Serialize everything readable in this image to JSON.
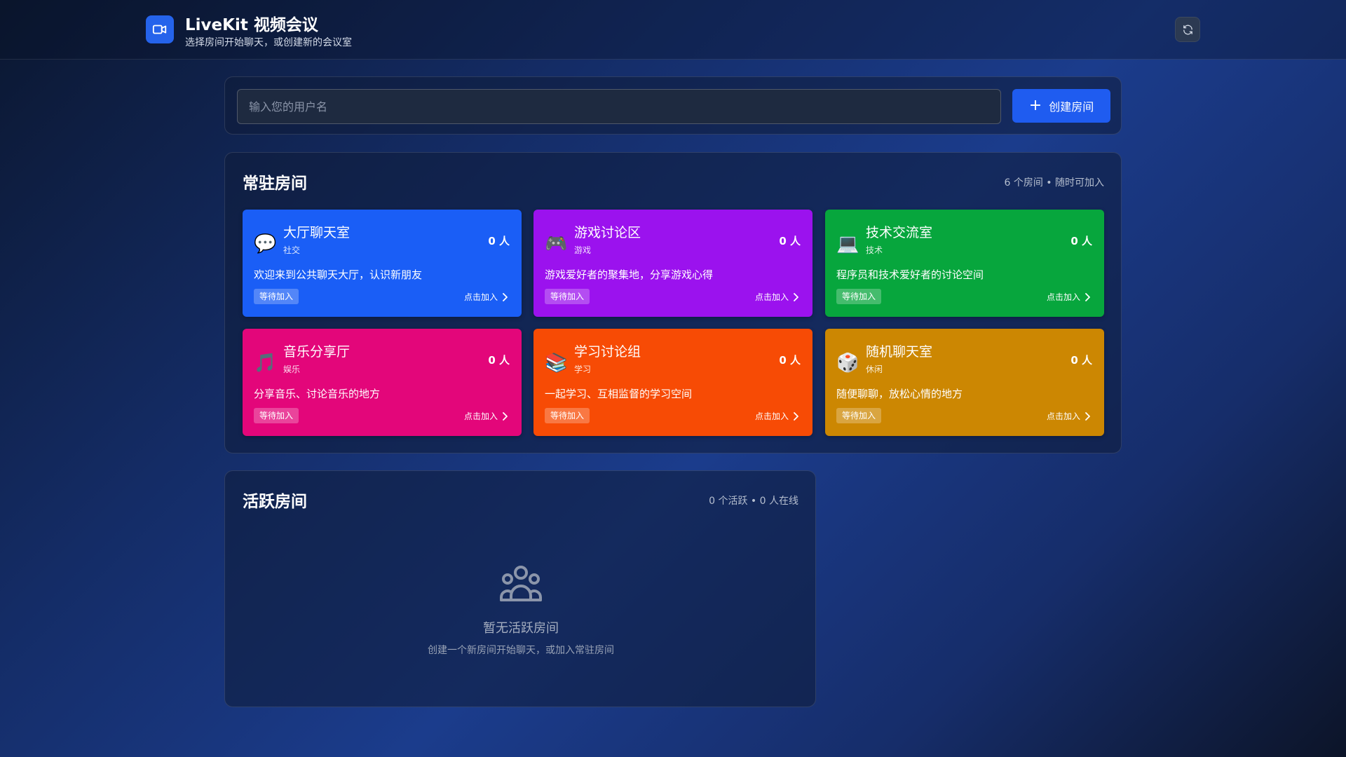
{
  "header": {
    "title": "LiveKit 视频会议",
    "subtitle": "选择房间开始聊天，或创建新的会议室",
    "logo_icon": "video-camera-icon",
    "refresh_icon": "refresh-icon"
  },
  "user_bar": {
    "username_placeholder": "输入您的用户名",
    "username_value": "",
    "create_button_label": "创建房间",
    "create_icon": "plus-icon"
  },
  "permanent_rooms": {
    "title": "常驻房间",
    "meta": "6 个房间 • 随时可加入",
    "rooms": [
      {
        "emoji": "💬",
        "icon": "speech-bubble-icon",
        "name": "大厅聊天室",
        "category": "社交",
        "count": "0 人",
        "description": "欢迎来到公共聊天大厅，认识新朋友",
        "status": "等待加入",
        "join_label": "点击加入",
        "color": "#1a5ef6"
      },
      {
        "emoji": "🎮",
        "icon": "game-controller-icon",
        "name": "游戏讨论区",
        "category": "游戏",
        "count": "0 人",
        "description": "游戏爱好者的聚集地，分享游戏心得",
        "status": "等待加入",
        "join_label": "点击加入",
        "color": "#9b12ee"
      },
      {
        "emoji": "💻",
        "icon": "laptop-icon",
        "name": "技术交流室",
        "category": "技术",
        "count": "0 人",
        "description": "程序员和技术爱好者的讨论空间",
        "status": "等待加入",
        "join_label": "点击加入",
        "color": "#07a63d"
      },
      {
        "emoji": "🎵",
        "icon": "music-note-icon",
        "name": "音乐分享厅",
        "category": "娱乐",
        "count": "0 人",
        "description": "分享音乐、讨论音乐的地方",
        "status": "等待加入",
        "join_label": "点击加入",
        "color": "#e3067a"
      },
      {
        "emoji": "📚",
        "icon": "books-icon",
        "name": "学习讨论组",
        "category": "学习",
        "count": "0 人",
        "description": "一起学习、互相监督的学习空间",
        "status": "等待加入",
        "join_label": "点击加入",
        "color": "#f74b05"
      },
      {
        "emoji": "🎲",
        "icon": "dice-icon",
        "name": "随机聊天室",
        "category": "休闲",
        "count": "0 人",
        "description": "随便聊聊，放松心情的地方",
        "status": "等待加入",
        "join_label": "点击加入",
        "color": "#cc8702"
      }
    ]
  },
  "active_rooms": {
    "title": "活跃房间",
    "meta": "0 个活跃 • 0 人在线",
    "empty_icon": "users-group-icon",
    "empty_title": "暂无活跃房间",
    "empty_subtitle": "创建一个新房间开始聊天，或加入常驻房间"
  }
}
